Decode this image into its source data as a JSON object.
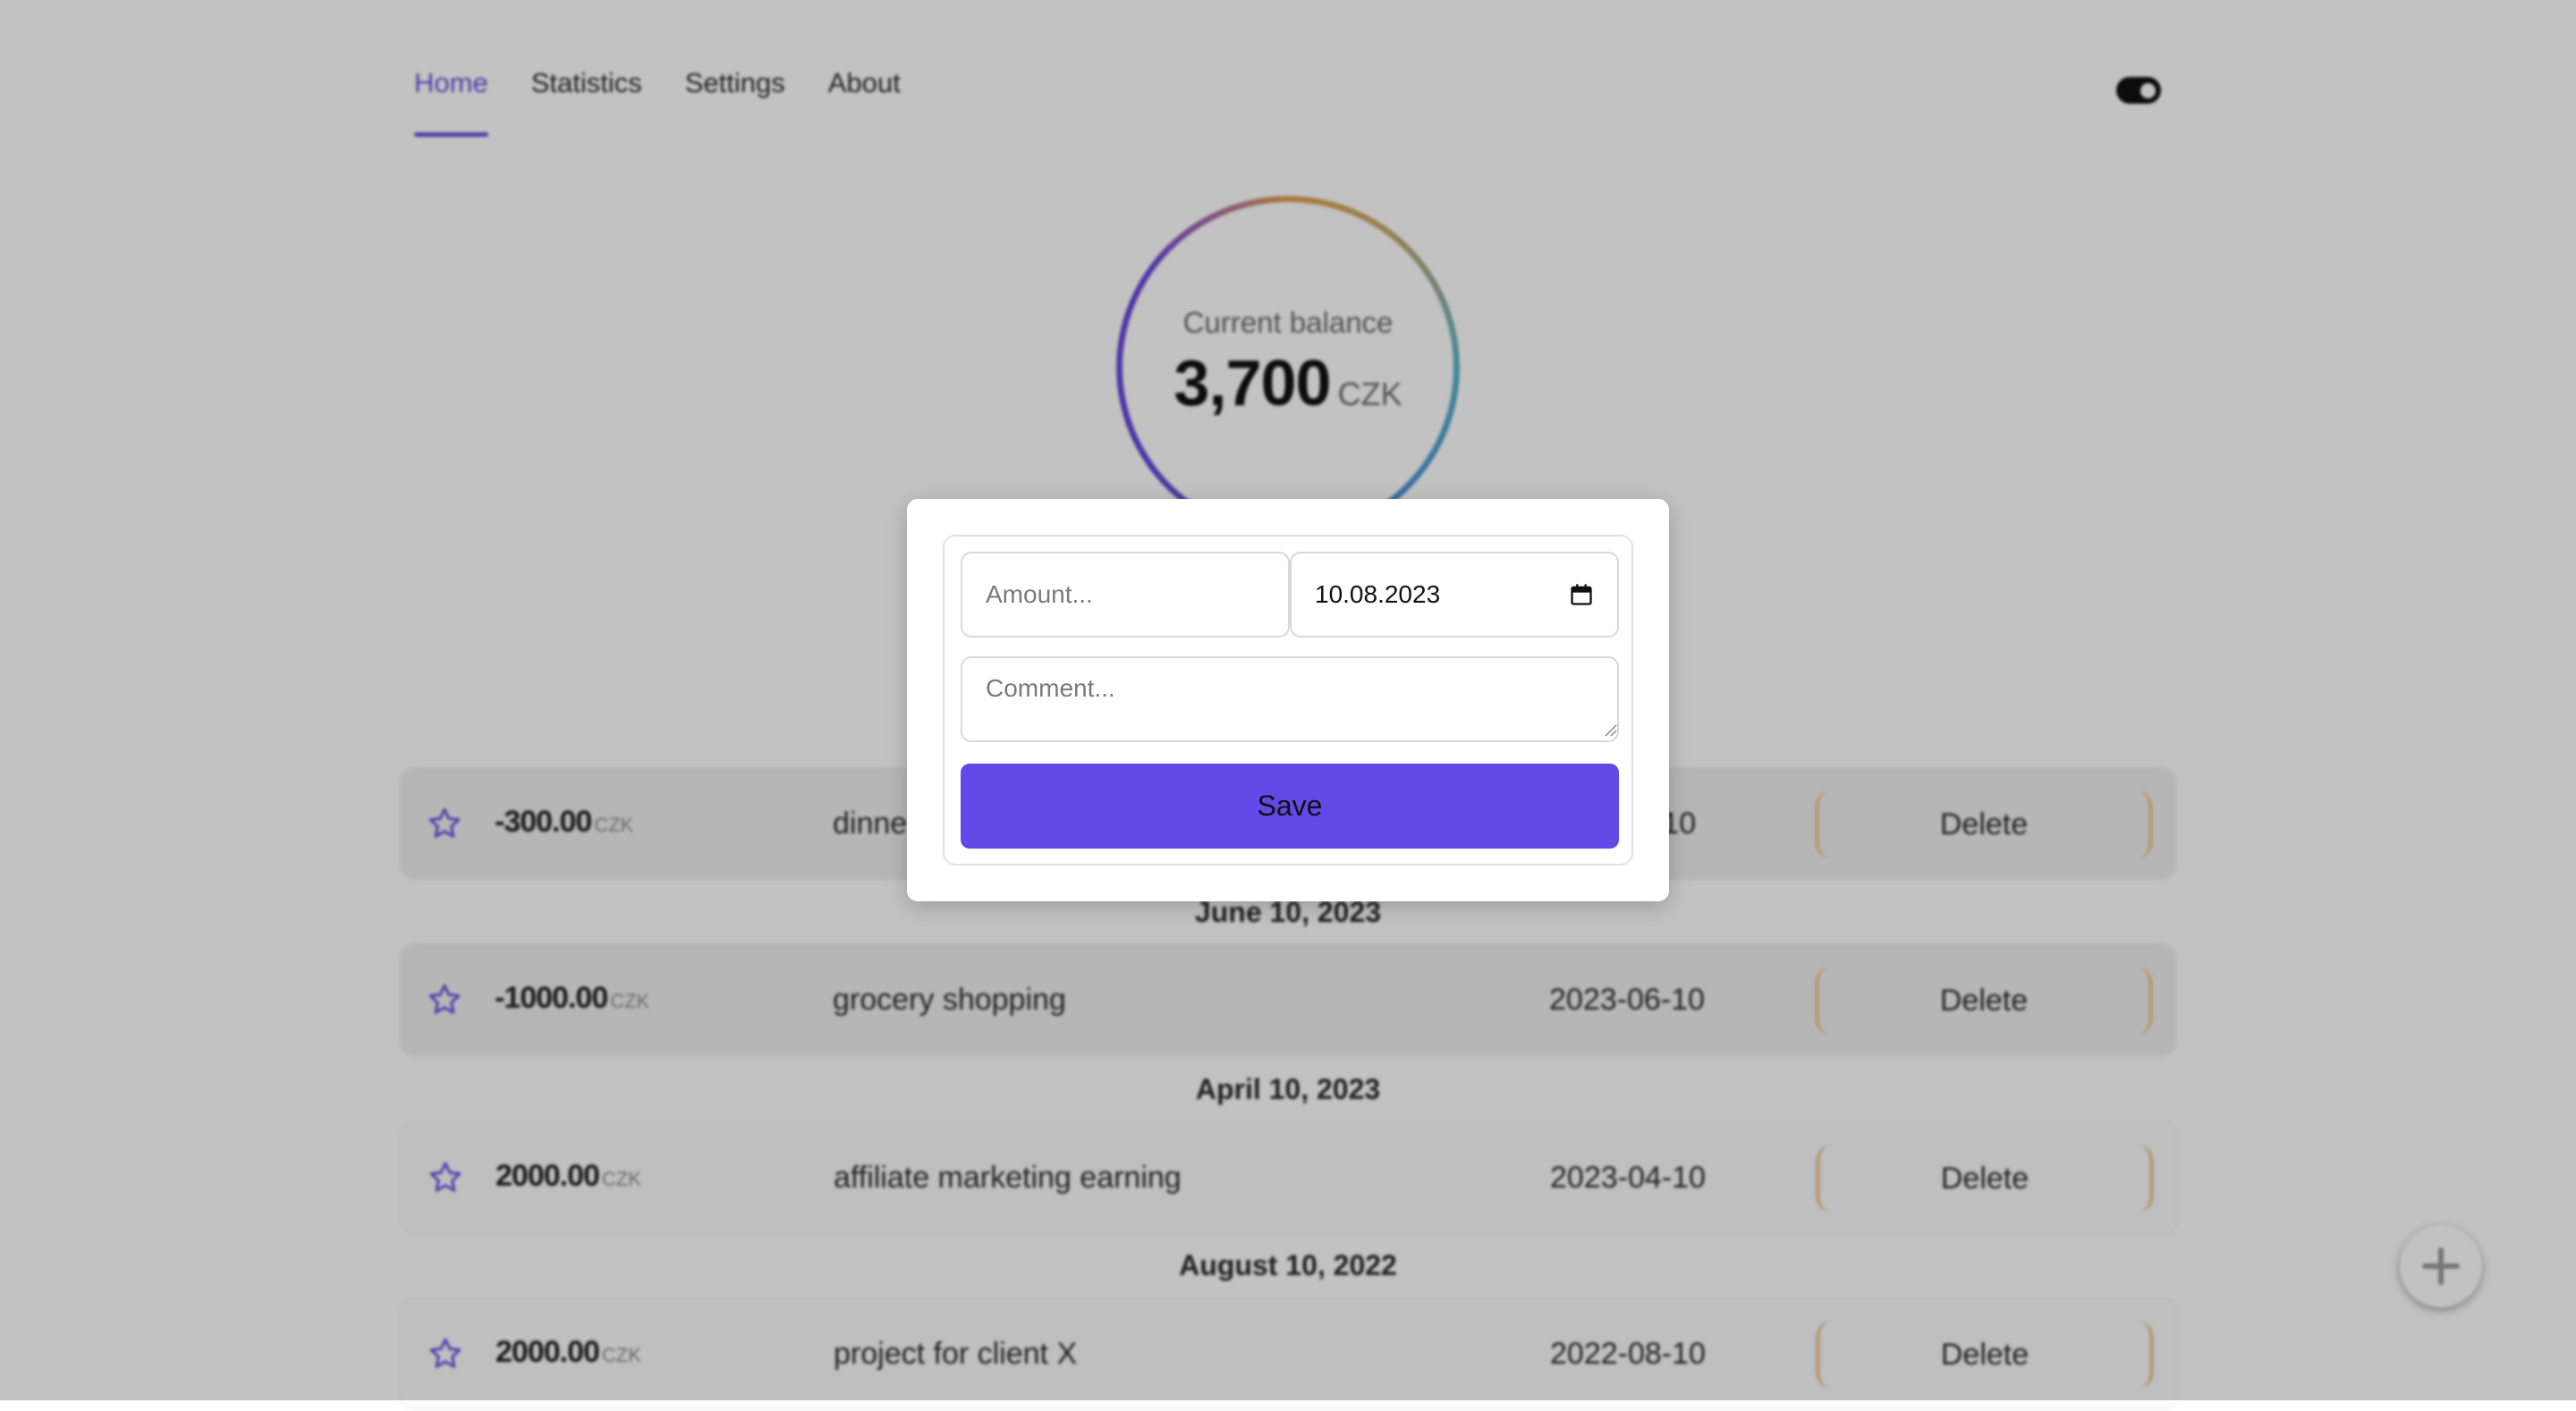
{
  "nav": {
    "items": [
      {
        "label": "Home",
        "active": true
      },
      {
        "label": "Statistics",
        "active": false
      },
      {
        "label": "Settings",
        "active": false
      },
      {
        "label": "About",
        "active": false
      }
    ],
    "theme_toggle": "toggle-icon"
  },
  "balance": {
    "label": "Current balance",
    "amount": "3,700",
    "currency": "CZK"
  },
  "transactions": [
    {
      "group_date": "",
      "amount": "-300.00",
      "currency": "CZK",
      "comment": "dinne",
      "date": "-10",
      "delete_label": "Delete"
    },
    {
      "group_date": "June 10, 2023",
      "amount": "-1000.00",
      "currency": "CZK",
      "comment": "grocery shopping",
      "date": "2023-06-10",
      "delete_label": "Delete"
    },
    {
      "group_date": "April 10, 2023",
      "amount": "2000.00",
      "currency": "CZK",
      "comment": "affiliate marketing earning",
      "date": "2023-04-10",
      "delete_label": "Delete"
    },
    {
      "group_date": "August 10, 2022",
      "amount": "2000.00",
      "currency": "CZK",
      "comment": "project for client X",
      "date": "2022-08-10",
      "delete_label": "Delete"
    }
  ],
  "modal": {
    "amount_placeholder": "Amount...",
    "date_value": "10.08.2023",
    "comment_placeholder": "Comment...",
    "save_label": "Save"
  },
  "colors": {
    "accent": "#6248e6",
    "delete_border": "#f2c9a0"
  },
  "icons": {
    "star": "star-icon",
    "add": "plus-icon",
    "calendar": "calendar-icon"
  }
}
